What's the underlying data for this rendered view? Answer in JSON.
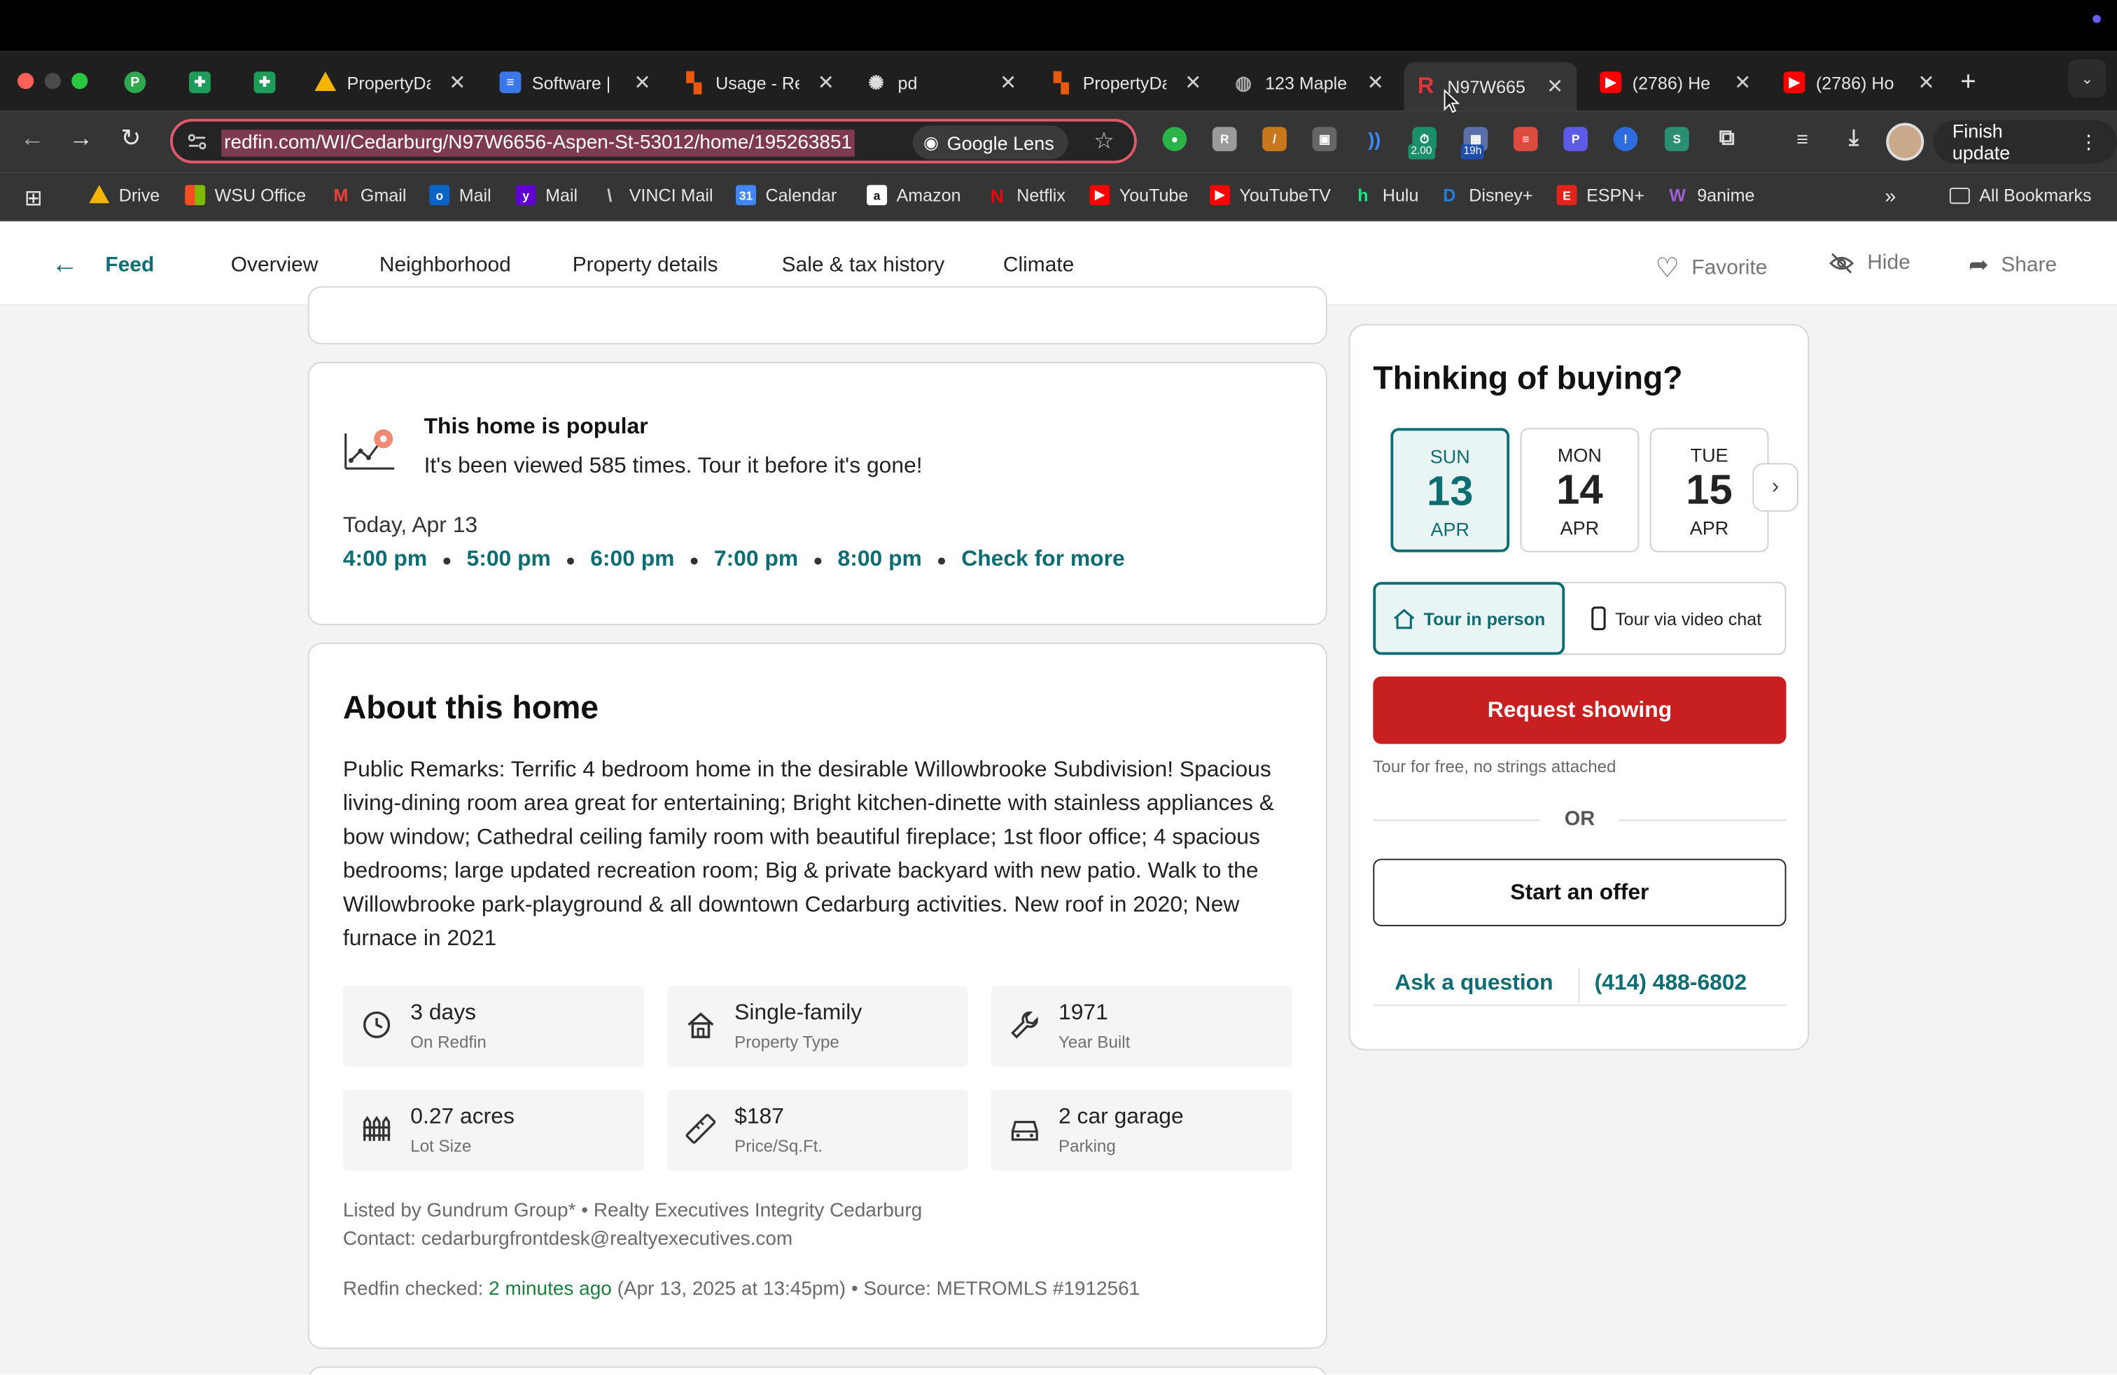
{
  "browser": {
    "tabs": [
      {
        "title": "",
        "icon": "p-green-icon",
        "color": "#2fa84f"
      },
      {
        "title": "",
        "icon": "sheets-icon",
        "color": "#1e9c5a"
      },
      {
        "title": "",
        "icon": "sheets-icon",
        "color": "#1e9c5a"
      },
      {
        "title": "PropertyDa",
        "icon": "drive-icon",
        "color": "#f4b400"
      },
      {
        "title": "Software |",
        "icon": "docs-icon",
        "color": "#3b78e7"
      },
      {
        "title": "Usage - Re",
        "icon": "chart-icon",
        "color": "#e8590c"
      },
      {
        "title": "pd",
        "icon": "openai-icon",
        "color": "#dddddd"
      },
      {
        "title": "PropertyDa",
        "icon": "chart-icon",
        "color": "#e8590c"
      },
      {
        "title": "123 Maple",
        "icon": "globe-icon",
        "color": "#888888"
      },
      {
        "title": "N97W665",
        "icon": "redfin-icon",
        "color": "#c82021"
      },
      {
        "title": "(2786) He",
        "icon": "youtube-icon",
        "color": "#ff0000"
      },
      {
        "title": "(2786) Ho",
        "icon": "youtube-icon",
        "color": "#ff0000"
      }
    ],
    "url": "redfin.com/WI/Cedarburg/N97W6656-Aspen-St-53012/home/195263851",
    "lens_label": "Google Lens",
    "ext_badges": {
      "timer": "2.00",
      "cal": "19h"
    },
    "finish_update": "Finish update",
    "bookmarks": [
      {
        "label": "Drive",
        "icon": "drive-icon",
        "color": "#f4b400"
      },
      {
        "label": "WSU Office",
        "icon": "office-icon",
        "color": "#e74c3c"
      },
      {
        "label": "Gmail",
        "icon": "gmail-icon",
        "color": "#ea4335"
      },
      {
        "label": "Mail",
        "icon": "outlook-icon",
        "color": "#0a64c8"
      },
      {
        "label": "Mail",
        "icon": "yahoo-icon",
        "color": "#6001d2"
      },
      {
        "label": "VINCI Mail",
        "icon": "vinci-icon",
        "color": "#1a3a8a"
      },
      {
        "label": "Calendar",
        "icon": "calendar-icon",
        "color": "#4285f4"
      },
      {
        "label": "Amazon",
        "icon": "amazon-icon",
        "color": "#ffffff"
      },
      {
        "label": "Netflix",
        "icon": "netflix-icon",
        "color": "#e50914"
      },
      {
        "label": "YouTube",
        "icon": "youtube-icon",
        "color": "#ff0000"
      },
      {
        "label": "YouTubeTV",
        "icon": "youtube-icon",
        "color": "#ff0000"
      },
      {
        "label": "Hulu",
        "icon": "hulu-icon",
        "color": "#1ce783"
      },
      {
        "label": "Disney+",
        "icon": "disney-icon",
        "color": "#1f80e0"
      },
      {
        "label": "ESPN+",
        "icon": "espn-icon",
        "color": "#e2231a"
      },
      {
        "label": "9anime",
        "icon": "anime-icon",
        "color": "#8e44ad"
      }
    ],
    "all_bookmarks": "All Bookmarks"
  },
  "pagenav": {
    "feed": "Feed",
    "links": [
      "Overview",
      "Neighborhood",
      "Property details",
      "Sale & tax history",
      "Climate"
    ],
    "favorite": "Favorite",
    "hide": "Hide",
    "share": "Share"
  },
  "popular": {
    "title": "This home is popular",
    "subtitle": "It's been viewed 585 times. Tour it before it's gone!",
    "date": "Today, Apr 13",
    "times": [
      "4:00 pm",
      "5:00 pm",
      "6:00 pm",
      "7:00 pm",
      "8:00 pm"
    ],
    "check_more": "Check for more"
  },
  "about": {
    "title": "About this home",
    "remarks": "Public Remarks: Terrific 4 bedroom home in the desirable Willowbrooke Subdivision! Spacious living-dining room area great for entertaining; Bright kitchen-dinette with stainless appliances & bow window; Cathedral ceiling family room with beautiful fireplace; 1st floor office; 4 spacious bedrooms; large updated recreation room; Big & private backyard with new patio. Walk to the Willowbrooke park-playground & all downtown Cedarburg activities. New roof in 2020; New furnace in 2021",
    "facts": [
      {
        "value": "3 days",
        "label": "On Redfin",
        "icon": "clock-icon"
      },
      {
        "value": "Single-family",
        "label": "Property Type",
        "icon": "house-icon"
      },
      {
        "value": "1971",
        "label": "Year Built",
        "icon": "wrench-icon"
      },
      {
        "value": "0.27 acres",
        "label": "Lot Size",
        "icon": "fence-icon"
      },
      {
        "value": "$187",
        "label": "Price/Sq.Ft.",
        "icon": "ruler-icon"
      },
      {
        "value": "2 car garage",
        "label": "Parking",
        "icon": "car-icon"
      }
    ],
    "listed_by": "Listed by Gundrum Group* •  Realty Executives Integrity Cedarburg",
    "contact": "Contact: cedarburgfrontdesk@realtyexecutives.com",
    "checked_prefix": "Redfin checked: ",
    "checked_ago": "2 minutes ago",
    "checked_suffix": " (Apr 13, 2025 at 13:45pm) • Source:  METROMLS #1912561"
  },
  "sidebar": {
    "title": "Thinking of buying?",
    "days": [
      {
        "weekday": "SUN",
        "day": "13",
        "month": "APR"
      },
      {
        "weekday": "MON",
        "day": "14",
        "month": "APR"
      },
      {
        "weekday": "TUE",
        "day": "15",
        "month": "APR"
      }
    ],
    "tour_in_person": "Tour in person",
    "tour_video": "Tour via video chat",
    "request": "Request showing",
    "tour_free": "Tour for free, no strings attached",
    "or": "OR",
    "offer": "Start an offer",
    "ask": "Ask a question",
    "phone": "(414) 488-6802"
  },
  "colors": {
    "accent": "#0d6d72",
    "primary_button": "#c82021",
    "omnibox_border": "#e05a6b"
  }
}
